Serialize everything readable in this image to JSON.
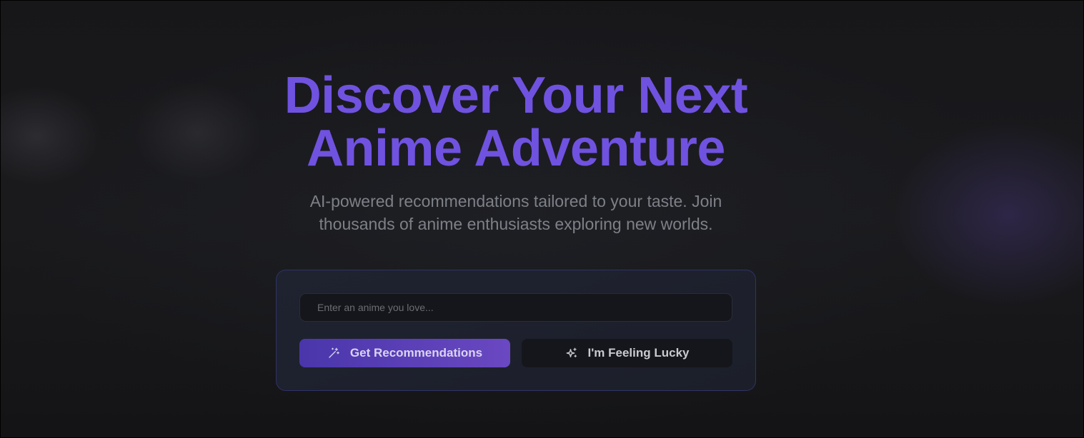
{
  "hero": {
    "headline_line1": "Discover Your Next",
    "headline_line2": "Anime Adventure",
    "subtitle_line1": "AI-powered recommendations tailored to your taste. Join",
    "subtitle_line2": "thousands of anime enthusiasts exploring new worlds."
  },
  "search": {
    "placeholder": "Enter an anime you love...",
    "value": ""
  },
  "actions": {
    "primary": {
      "label": "Get Recommendations",
      "icon": "magic-wand-icon"
    },
    "secondary": {
      "label": "I'm Feeling Lucky",
      "icon": "sparkles-icon"
    }
  },
  "colors": {
    "accent": "#7052e0",
    "primary_button_start": "#4a36ab",
    "primary_button_end": "#6a48c2",
    "background": "#161619",
    "card_border": "#2f3266"
  }
}
